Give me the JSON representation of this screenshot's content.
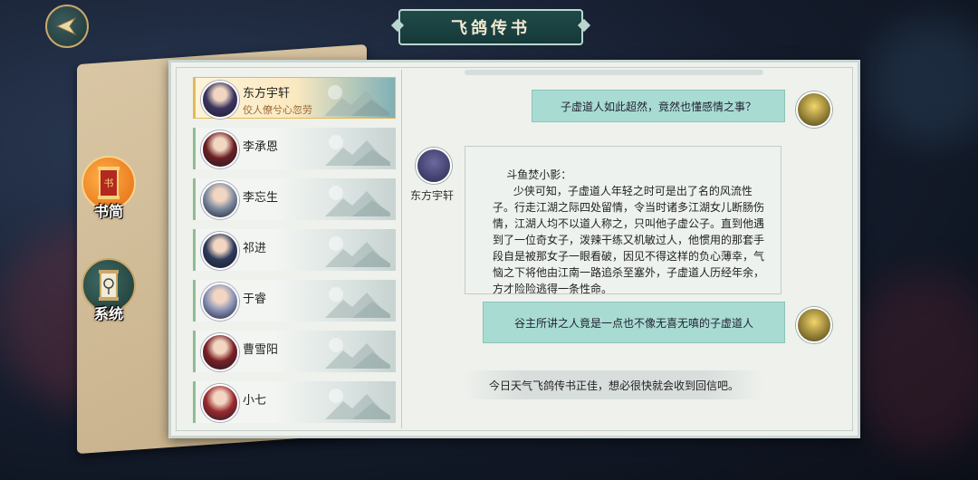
{
  "header": {
    "title": "飞鸽传书",
    "back_icon": "back-arrow-icon"
  },
  "side_menu": {
    "letters": {
      "label": "书简",
      "icon": "scroll-icon",
      "emblem_text": "书"
    },
    "system": {
      "label": "系统",
      "icon": "lantern-icon"
    }
  },
  "contacts": [
    {
      "name": "东方宇轩",
      "subtitle": "佼人僚兮心忽劳",
      "active": true,
      "avatar_color": "#3b3560"
    },
    {
      "name": "李承恩",
      "active": false,
      "avatar_color": "#6a1f22"
    },
    {
      "name": "李忘生",
      "active": false,
      "avatar_color": "#7d8aa0"
    },
    {
      "name": "祁进",
      "active": false,
      "avatar_color": "#2d3a5a"
    },
    {
      "name": "于睿",
      "active": false,
      "avatar_color": "#8a93b8"
    },
    {
      "name": "曹雪阳",
      "active": false,
      "avatar_color": "#7a1f24"
    },
    {
      "name": "小七",
      "active": false,
      "avatar_color": "#9a2a2e"
    }
  ],
  "chat": {
    "messages": [
      {
        "from": "self",
        "text": "子虚道人如此超然，竟然也懂感情之事？"
      },
      {
        "from": "other",
        "sender": "东方宇轩",
        "text": "斗鱼焚小影：\n      少侠可知，子虚道人年轻之时可是出了名的风流性子。行走江湖之际四处留情，令当时诸多江湖女儿断肠伤情，江湖人均不以道人称之，只叫他子虚公子。直到他遇到了一位奇女子，泼辣干练又机敏过人，他惯用的那套手段自是被那女子一眼看破，因见不得这样的负心薄幸，气恼之下将他由江南一路追杀至塞外，子虚道人历经年余，方才险险逃得一条性命。"
      },
      {
        "from": "self",
        "text": "谷主所讲之人竟是一点也不像无喜无嗔的子虚道人"
      }
    ],
    "system_message": "今日天气飞鸽传书正佳，想必很快就会收到回信吧。"
  },
  "colors": {
    "accent_teal": "#a8dcd2",
    "active_gold": "#e2b95a",
    "banner": "#1f4a47"
  }
}
